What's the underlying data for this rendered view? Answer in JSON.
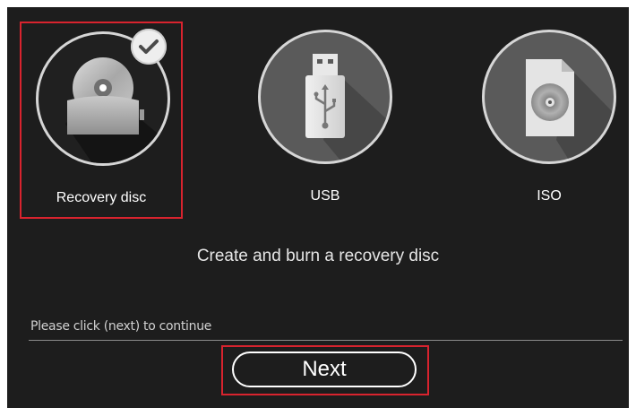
{
  "options": [
    {
      "label": "Recovery disc",
      "icon": "recovery-disc-drive-icon",
      "selected": true
    },
    {
      "label": "USB",
      "icon": "usb-drive-icon",
      "selected": false
    },
    {
      "label": "ISO",
      "icon": "iso-file-icon",
      "selected": false
    }
  ],
  "headline": "Create and burn a recovery disc",
  "hint": "Please click (next) to continue",
  "next_label": "Next",
  "colors": {
    "panel": "#1d1d1d",
    "selection_border": "#d8232e",
    "text": "#ffffff"
  }
}
